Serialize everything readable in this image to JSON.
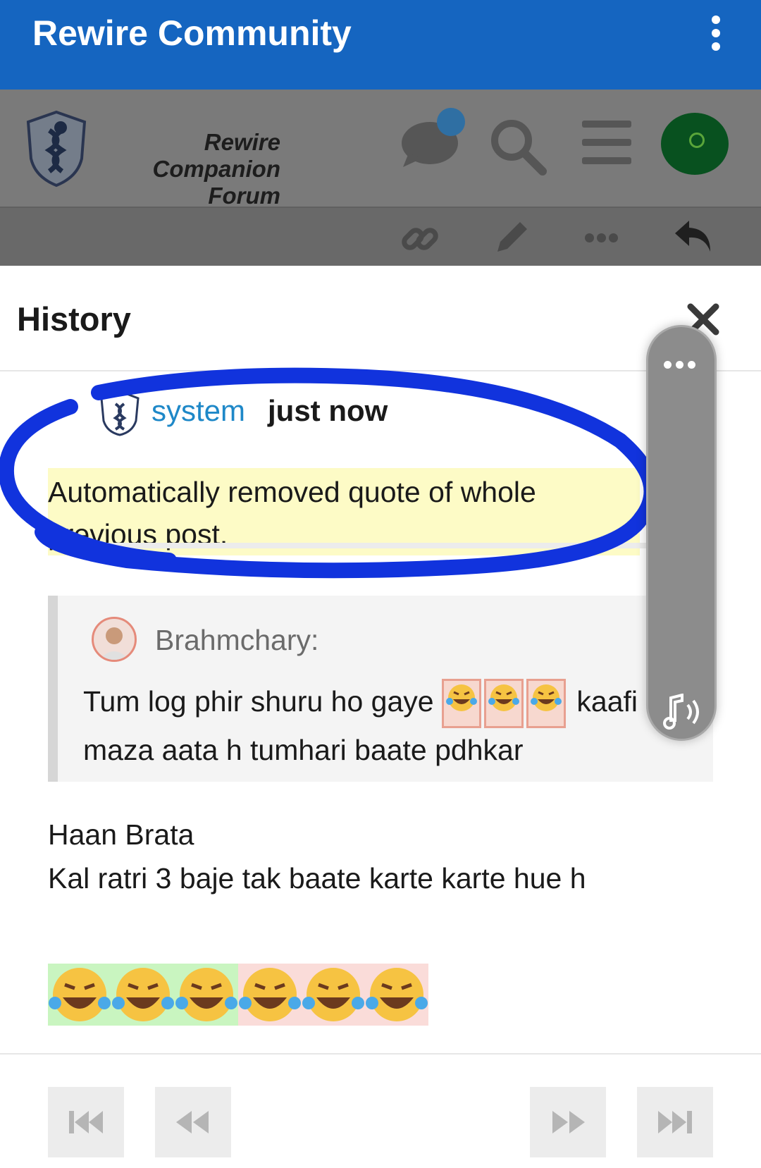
{
  "appbar": {
    "title": "Rewire Community",
    "more_icon": "vertical-dots-icon"
  },
  "forum_header": {
    "logo_line1": "Rewire Companion",
    "logo_line2": "Forum",
    "icons": [
      "chat-icon",
      "search-icon",
      "hamburger-icon",
      "avatar"
    ]
  },
  "post_toolbar": {
    "icons": [
      "link-icon",
      "pencil-icon",
      "more-dots-icon",
      "reply-icon"
    ]
  },
  "history_modal": {
    "title": "History",
    "revision": {
      "author": "system",
      "time": "just now",
      "reason": "Automatically removed quote of whole previous post."
    },
    "quote": {
      "author": "Brahmchary:",
      "text_before": "Tum log phir shuru ho gaye",
      "text_after": "kaafi maza aata h tumhari baate pdhkar",
      "emoji": "😂",
      "emoji_count": 3
    },
    "body_line1": "Haan Brata",
    "body_line2": "Kal ratri 3 baje tak baate karte karte hue h",
    "emoji_inserted_count": 3,
    "emoji_deleted_count": 3,
    "nav": [
      "first-revision-icon",
      "previous-revision-icon",
      "next-revision-icon",
      "last-revision-icon"
    ]
  },
  "colors": {
    "appbar": "#1565c0",
    "username": "#1e88c8",
    "annotation": "#1133dd",
    "reason_bg": "#fdfbc6",
    "inserted_bg": "#c9f5c0",
    "deleted_bg": "#fadcd9"
  }
}
